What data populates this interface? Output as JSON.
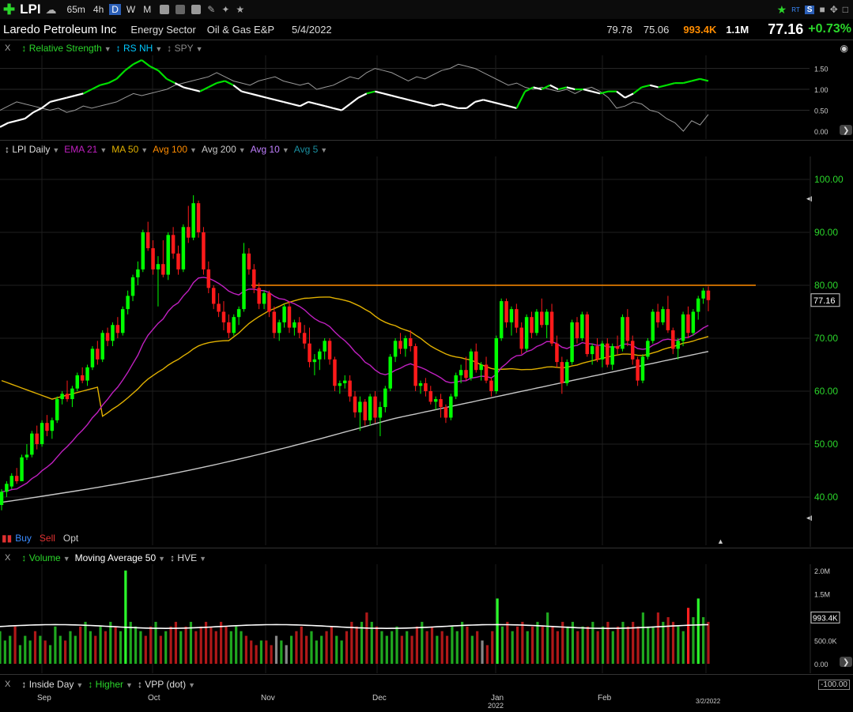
{
  "toolbar": {
    "add_icon": "plus-icon",
    "symbol": "LPI",
    "timeframes": [
      "65m",
      "4h",
      "D",
      "W",
      "M"
    ],
    "active_timeframe": "D"
  },
  "info": {
    "company": "Laredo Petroleum Inc",
    "sector": "Energy Sector",
    "industry": "Oil & Gas E&P",
    "date": "5/4/2022",
    "high": "79.78",
    "low": "75.06",
    "volume_short": "993.4K",
    "avg_volume": "1.1M",
    "last": "77.16",
    "change": "+0.73%",
    "rt_label": "RT",
    "s_label": "S"
  },
  "rs_panel": {
    "close": "X",
    "items": [
      "Relative Strength",
      "RS NH",
      "SPY"
    ],
    "axis": [
      "1.50",
      "1.00",
      "0.50",
      "0.00"
    ]
  },
  "price_panel": {
    "items": [
      "LPI Daily",
      "EMA 21",
      "MA 50",
      "Avg 100",
      "Avg 200",
      "Avg 10",
      "Avg 5"
    ],
    "axis": [
      "100.00",
      "90.00",
      "80.00",
      "70.00",
      "60.00",
      "50.00",
      "40.00"
    ],
    "price_tag": "77.16",
    "resistance": 80.0
  },
  "trade": {
    "buy": "Buy",
    "sell": "Sell",
    "opt": "Opt"
  },
  "volume_panel": {
    "close": "X",
    "items": [
      "Volume",
      "Moving Average 50",
      "HVE"
    ],
    "axis": [
      "2.0M",
      "1.5M",
      "1.0M",
      "500.0K",
      "0.00"
    ],
    "tag": "993.4K"
  },
  "bottom_panel": {
    "close": "X",
    "items": [
      "Inside Day",
      "Higher",
      "VPP (dot)"
    ],
    "axis_cut": "-100.00"
  },
  "xaxis": {
    "months": [
      "Sep",
      "Oct",
      "Nov",
      "Dec",
      "Jan",
      "Feb"
    ],
    "year": "2022",
    "last_date": "3/2/2022"
  },
  "colors": {
    "up": "#00ff00",
    "down": "#ff1a1a",
    "ema21": "#c020c0",
    "ma50": "#e0b000",
    "avg100": "#ff8c00",
    "avg200": "#c8c8c8",
    "rs": "#00e000",
    "accent": "#2b5fb7"
  },
  "chart_data": {
    "type": "candlestick",
    "symbol": "LPI",
    "y_range": [
      35,
      106
    ],
    "resistance_level": 80.0,
    "candles_ohlc": [
      [
        38.5,
        41.5,
        37.5,
        41.0
      ],
      [
        41.0,
        43.0,
        40.0,
        42.5
      ],
      [
        42.0,
        44.5,
        41.5,
        44.0
      ],
      [
        44.0,
        45.5,
        42.5,
        43.0
      ],
      [
        43.0,
        48.0,
        43.0,
        47.5
      ],
      [
        47.5,
        50.0,
        47.0,
        48.0
      ],
      [
        48.0,
        52.5,
        47.5,
        52.0
      ],
      [
        52.0,
        53.5,
        49.0,
        50.0
      ],
      [
        50.0,
        54.5,
        49.5,
        54.0
      ],
      [
        54.0,
        55.5,
        51.5,
        52.5
      ],
      [
        52.5,
        55.0,
        51.0,
        54.5
      ],
      [
        54.5,
        59.0,
        54.0,
        58.5
      ],
      [
        58.5,
        60.0,
        57.5,
        59.5
      ],
      [
        59.5,
        62.0,
        58.0,
        58.5
      ],
      [
        58.5,
        61.0,
        57.0,
        60.5
      ],
      [
        60.5,
        63.5,
        60.0,
        63.0
      ],
      [
        63.0,
        64.5,
        61.5,
        62.0
      ],
      [
        62.0,
        65.0,
        61.0,
        64.5
      ],
      [
        64.5,
        68.5,
        64.0,
        68.0
      ],
      [
        68.0,
        69.5,
        65.0,
        66.0
      ],
      [
        66.0,
        71.5,
        65.5,
        71.0
      ],
      [
        71.0,
        72.0,
        68.5,
        69.5
      ],
      [
        69.5,
        73.0,
        68.5,
        72.5
      ],
      [
        72.5,
        74.0,
        70.0,
        71.0
      ],
      [
        71.0,
        76.0,
        70.5,
        75.5
      ],
      [
        75.5,
        79.0,
        74.5,
        78.0
      ],
      [
        78.0,
        82.0,
        77.0,
        81.5
      ],
      [
        81.5,
        84.5,
        80.0,
        83.0
      ],
      [
        83.0,
        90.5,
        82.5,
        90.0
      ],
      [
        90.0,
        92.0,
        86.5,
        87.0
      ],
      [
        87.0,
        88.5,
        82.0,
        83.0
      ],
      [
        83.0,
        85.5,
        76.0,
        84.0
      ],
      [
        84.0,
        88.5,
        81.5,
        82.0
      ],
      [
        82.0,
        90.0,
        81.0,
        89.5
      ],
      [
        89.5,
        91.0,
        85.0,
        86.0
      ],
      [
        86.0,
        87.5,
        82.0,
        83.0
      ],
      [
        83.0,
        91.5,
        82.5,
        91.0
      ],
      [
        91.0,
        95.0,
        88.0,
        89.0
      ],
      [
        89.0,
        97.0,
        88.5,
        95.5
      ],
      [
        95.5,
        96.0,
        89.0,
        90.0
      ],
      [
        90.0,
        91.0,
        82.0,
        83.0
      ],
      [
        83.0,
        84.5,
        78.5,
        79.5
      ],
      [
        79.5,
        80.0,
        75.5,
        76.5
      ],
      [
        76.5,
        78.5,
        74.0,
        75.0
      ],
      [
        75.0,
        77.0,
        71.5,
        73.0
      ],
      [
        73.0,
        74.5,
        70.0,
        71.0
      ],
      [
        71.0,
        74.5,
        70.5,
        74.0
      ],
      [
        74.0,
        76.0,
        72.5,
        75.5
      ],
      [
        75.5,
        88.0,
        75.0,
        86.0
      ],
      [
        86.0,
        87.0,
        82.0,
        83.0
      ],
      [
        83.0,
        84.0,
        78.5,
        79.5
      ],
      [
        79.5,
        80.5,
        75.5,
        76.5
      ],
      [
        76.5,
        79.0,
        75.5,
        78.5
      ],
      [
        78.5,
        79.0,
        74.0,
        75.0
      ],
      [
        75.0,
        76.0,
        70.0,
        71.0
      ],
      [
        71.0,
        73.5,
        69.5,
        73.0
      ],
      [
        73.0,
        76.5,
        72.0,
        76.0
      ],
      [
        76.0,
        77.0,
        71.0,
        72.0
      ],
      [
        72.0,
        73.5,
        70.5,
        73.0
      ],
      [
        73.0,
        74.0,
        70.0,
        71.0
      ],
      [
        71.0,
        72.5,
        68.0,
        69.0
      ],
      [
        69.0,
        72.0,
        64.5,
        65.5
      ],
      [
        65.5,
        67.0,
        63.0,
        66.0
      ],
      [
        66.0,
        68.0,
        64.0,
        67.5
      ],
      [
        67.5,
        70.0,
        66.0,
        69.5
      ],
      [
        69.5,
        70.0,
        65.0,
        66.0
      ],
      [
        66.0,
        66.5,
        60.0,
        61.0
      ],
      [
        61.0,
        62.0,
        59.5,
        61.5
      ],
      [
        61.5,
        63.0,
        60.5,
        62.0
      ],
      [
        62.0,
        63.0,
        58.0,
        59.0
      ],
      [
        59.0,
        60.0,
        55.0,
        56.0
      ],
      [
        56.0,
        59.0,
        52.5,
        58.0
      ],
      [
        58.0,
        58.5,
        53.5,
        54.5
      ],
      [
        54.5,
        59.5,
        53.5,
        59.0
      ],
      [
        59.0,
        60.0,
        54.0,
        55.0
      ],
      [
        55.0,
        58.0,
        51.5,
        57.0
      ],
      [
        57.0,
        61.0,
        56.0,
        60.5
      ],
      [
        60.5,
        67.0,
        60.0,
        66.5
      ],
      [
        66.5,
        70.0,
        65.5,
        69.5
      ],
      [
        69.5,
        71.0,
        67.0,
        68.0
      ],
      [
        68.0,
        70.5,
        66.5,
        70.0
      ],
      [
        70.0,
        71.5,
        67.5,
        68.5
      ],
      [
        68.5,
        69.0,
        60.0,
        61.0
      ],
      [
        61.0,
        62.0,
        59.5,
        61.5
      ],
      [
        61.5,
        62.5,
        59.0,
        60.0
      ],
      [
        60.0,
        61.0,
        57.5,
        58.0
      ],
      [
        58.0,
        59.0,
        56.5,
        58.5
      ],
      [
        58.5,
        59.5,
        55.0,
        57.0
      ],
      [
        57.0,
        57.5,
        54.0,
        55.0
      ],
      [
        55.0,
        59.5,
        54.5,
        59.0
      ],
      [
        59.0,
        63.5,
        58.5,
        63.0
      ],
      [
        63.0,
        65.0,
        61.5,
        64.0
      ],
      [
        64.0,
        66.5,
        62.0,
        62.5
      ],
      [
        62.5,
        68.0,
        62.0,
        67.5
      ],
      [
        67.5,
        69.0,
        63.5,
        64.0
      ],
      [
        64.0,
        65.5,
        62.0,
        65.0
      ],
      [
        65.0,
        66.5,
        61.5,
        62.0
      ],
      [
        62.0,
        62.5,
        59.0,
        60.0
      ],
      [
        60.0,
        70.5,
        59.5,
        70.0
      ],
      [
        70.0,
        77.5,
        69.5,
        77.0
      ],
      [
        77.0,
        77.5,
        72.0,
        73.0
      ],
      [
        73.0,
        76.0,
        70.5,
        75.5
      ],
      [
        75.5,
        76.5,
        71.0,
        72.0
      ],
      [
        72.0,
        73.0,
        67.0,
        68.0
      ],
      [
        68.0,
        74.5,
        67.5,
        74.0
      ],
      [
        74.0,
        75.0,
        70.0,
        71.0
      ],
      [
        71.0,
        75.5,
        70.5,
        75.0
      ],
      [
        75.0,
        77.5,
        72.0,
        72.5
      ],
      [
        72.5,
        75.5,
        70.0,
        75.0
      ],
      [
        75.0,
        76.5,
        68.5,
        69.0
      ],
      [
        69.0,
        70.5,
        64.5,
        65.5
      ],
      [
        65.5,
        66.5,
        59.5,
        61.5
      ],
      [
        61.5,
        66.0,
        61.0,
        65.5
      ],
      [
        65.5,
        73.5,
        65.0,
        73.0
      ],
      [
        73.0,
        74.0,
        69.0,
        70.0
      ],
      [
        70.0,
        75.0,
        69.5,
        74.5
      ],
      [
        74.5,
        75.0,
        66.5,
        67.0
      ],
      [
        67.0,
        69.0,
        65.0,
        68.5
      ],
      [
        68.5,
        70.0,
        65.5,
        66.0
      ],
      [
        66.0,
        69.5,
        64.5,
        69.0
      ],
      [
        69.0,
        70.0,
        64.5,
        65.0
      ],
      [
        65.0,
        69.0,
        64.0,
        68.5
      ],
      [
        68.5,
        70.5,
        67.0,
        68.0
      ],
      [
        68.0,
        74.5,
        67.5,
        74.0
      ],
      [
        74.0,
        75.5,
        68.5,
        69.5
      ],
      [
        69.5,
        70.5,
        65.0,
        66.0
      ],
      [
        66.0,
        66.5,
        61.0,
        62.0
      ],
      [
        62.0,
        67.0,
        61.5,
        66.5
      ],
      [
        66.5,
        70.0,
        66.0,
        69.5
      ],
      [
        69.5,
        75.5,
        69.0,
        75.0
      ],
      [
        75.0,
        76.5,
        72.0,
        73.0
      ],
      [
        73.0,
        76.0,
        72.5,
        75.5
      ],
      [
        75.5,
        78.0,
        71.0,
        71.5
      ],
      [
        71.5,
        72.0,
        67.0,
        68.0
      ],
      [
        68.0,
        70.0,
        66.0,
        69.5
      ],
      [
        69.5,
        75.0,
        68.5,
        74.5
      ],
      [
        74.5,
        76.0,
        70.0,
        71.0
      ],
      [
        71.0,
        75.5,
        70.5,
        75.0
      ],
      [
        75.0,
        78.0,
        73.5,
        77.5
      ],
      [
        77.5,
        79.5,
        76.5,
        79.0
      ],
      [
        79.0,
        79.8,
        75.1,
        77.2
      ]
    ],
    "volume_millions": [
      0.7,
      0.5,
      0.6,
      0.8,
      0.4,
      0.6,
      0.5,
      0.7,
      0.6,
      0.5,
      0.4,
      0.8,
      0.6,
      0.5,
      0.7,
      0.6,
      0.8,
      0.9,
      0.7,
      0.6,
      0.8,
      0.7,
      0.9,
      0.8,
      0.7,
      2.0,
      0.9,
      0.8,
      0.7,
      0.6,
      0.8,
      0.9,
      0.6,
      0.7,
      0.8,
      0.9,
      0.7,
      0.8,
      0.9,
      0.7,
      0.8,
      0.9,
      0.8,
      0.7,
      0.9,
      0.8,
      0.7,
      0.8,
      0.7,
      0.6,
      0.5,
      0.4,
      0.5,
      0.5,
      0.4,
      0.6,
      0.5,
      0.4,
      0.6,
      0.7,
      0.8,
      0.6,
      0.7,
      0.5,
      0.6,
      0.7,
      0.8,
      0.6,
      0.5,
      0.7,
      0.9,
      0.8,
      0.9,
      1.1,
      0.9,
      0.8,
      0.7,
      0.6,
      0.7,
      0.8,
      0.6,
      0.7,
      0.6,
      0.8,
      0.9,
      0.7,
      0.8,
      0.6,
      0.7,
      0.6,
      0.8,
      0.7,
      0.9,
      0.8,
      0.6,
      0.7,
      0.5,
      0.4,
      0.7,
      1.4,
      0.8,
      0.9,
      0.7,
      0.8,
      0.9,
      0.7,
      0.8,
      0.9,
      0.8,
      1.1,
      0.8,
      0.7,
      0.9,
      0.8,
      0.9,
      0.7,
      0.8,
      0.8,
      0.9,
      0.7,
      0.8,
      0.9,
      0.7,
      0.8,
      0.9,
      0.8,
      0.9,
      0.8,
      1.1,
      0.8,
      0.8,
      1.1,
      0.9,
      1.0,
      0.9,
      0.8,
      0.7,
      1.2,
      1.0,
      1.4,
      1.0,
      0.9
    ],
    "volume_ma_millions": 0.8,
    "rs_range": [
      0.0,
      1.7
    ],
    "relative_strength": [
      0.1,
      0.2,
      0.25,
      0.3,
      0.45,
      0.55,
      0.7,
      0.75,
      0.8,
      0.85,
      0.9,
      1.0,
      1.1,
      1.15,
      1.25,
      1.45,
      1.6,
      1.7,
      1.55,
      1.45,
      1.25,
      1.15,
      1.05,
      1.0,
      0.95,
      1.05,
      1.15,
      1.2,
      1.1,
      0.95,
      0.9,
      0.85,
      0.8,
      0.75,
      0.7,
      0.65,
      0.6,
      0.7,
      0.65,
      0.6,
      0.55,
      0.5,
      0.65,
      0.8,
      0.9,
      0.95,
      0.9,
      0.85,
      0.8,
      0.75,
      0.7,
      0.65,
      0.6,
      0.65,
      0.6,
      0.55,
      0.55,
      0.7,
      0.75,
      0.7,
      0.65,
      0.6,
      0.55,
      0.95,
      1.05,
      1.0,
      1.1,
      1.0,
      1.05,
      1.0,
      1.0,
      0.95,
      0.9,
      0.95,
      0.95,
      0.8,
      0.9,
      1.05,
      1.1,
      1.05,
      1.1,
      1.15,
      1.15,
      1.2,
      1.25,
      1.2
    ],
    "rs_spy": [
      0.5,
      0.6,
      0.7,
      0.65,
      0.6,
      0.55,
      0.5,
      0.55,
      0.45,
      0.5,
      0.6,
      0.55,
      0.6,
      0.65,
      0.7,
      0.8,
      0.9,
      0.85,
      0.9,
      0.95,
      1.0,
      1.1,
      1.15,
      1.2,
      1.25,
      1.3,
      1.4,
      1.3,
      1.2,
      1.15,
      1.1,
      1.2,
      1.25,
      1.3,
      1.2,
      1.15,
      1.1,
      1.15,
      1.0,
      1.05,
      1.1,
      1.2,
      1.3,
      1.25,
      1.4,
      1.5,
      1.45,
      1.4,
      1.3,
      1.2,
      1.3,
      1.25,
      1.35,
      1.45,
      1.5,
      1.6,
      1.55,
      1.5,
      1.4,
      1.3,
      1.2,
      1.1,
      1.15,
      1.05,
      1.0,
      1.05,
      1.0,
      0.95,
      1.0,
      0.9,
      1.0,
      1.05,
      0.95,
      0.8,
      0.55,
      0.6,
      0.7,
      0.65,
      0.5,
      0.45,
      0.3,
      0.2,
      0.0,
      0.25,
      0.15,
      0.4
    ],
    "month_labels": [
      "Sep",
      "Oct",
      "Nov",
      "Dec",
      "Jan",
      "Feb",
      "3/2/2022"
    ]
  }
}
